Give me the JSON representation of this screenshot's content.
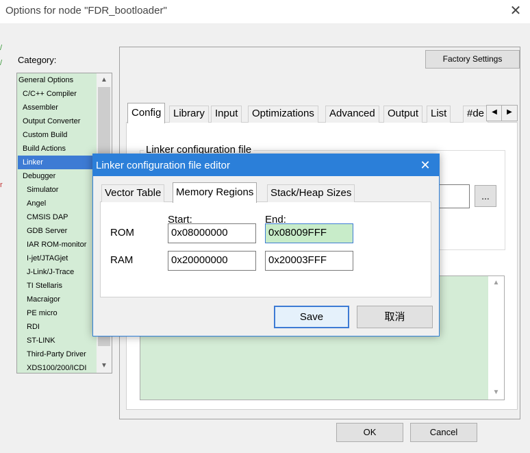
{
  "window": {
    "title": "Options for node \"FDR_bootloader\""
  },
  "category": {
    "label": "Category:",
    "items": [
      {
        "label": "General Options"
      },
      {
        "label": "C/C++ Compiler"
      },
      {
        "label": "Assembler"
      },
      {
        "label": "Output Converter"
      },
      {
        "label": "Custom Build"
      },
      {
        "label": "Build Actions"
      },
      {
        "label": "Linker"
      },
      {
        "label": "Debugger"
      },
      {
        "label": "Simulator"
      },
      {
        "label": "Angel"
      },
      {
        "label": "CMSIS DAP"
      },
      {
        "label": "GDB Server"
      },
      {
        "label": "IAR ROM-monitor"
      },
      {
        "label": "I-jet/JTAGjet"
      },
      {
        "label": "J-Link/J-Trace"
      },
      {
        "label": "TI Stellaris"
      },
      {
        "label": "Macraigor"
      },
      {
        "label": "PE micro"
      },
      {
        "label": "RDI"
      },
      {
        "label": "ST-LINK"
      },
      {
        "label": "Third-Party Driver"
      },
      {
        "label": "XDS100/200/ICDI"
      }
    ],
    "selected": "Linker"
  },
  "right_panel": {
    "factory_settings": "Factory Settings",
    "tabs": [
      "Config",
      "Library",
      "Input",
      "Optimizations",
      "Advanced",
      "Output",
      "List",
      "#de"
    ],
    "active_tab": "Config",
    "linker_config_label": "Linker configuration file",
    "browse_label": "..."
  },
  "footer": {
    "ok": "OK",
    "cancel": "Cancel"
  },
  "editor": {
    "title": "Linker configuration file editor",
    "tabs": [
      "Vector Table",
      "Memory Regions",
      "Stack/Heap Sizes"
    ],
    "active_tab": "Memory Regions",
    "start_label": "Start:",
    "end_label": "End:",
    "rom": {
      "label": "ROM",
      "start": "0x08000000",
      "end": "0x08009FFF"
    },
    "ram": {
      "label": "RAM",
      "start": "0x20000000",
      "end": "0x20003FFF"
    },
    "save": "Save",
    "cancel": "取消"
  },
  "colors": {
    "accent": "#2b7fd9",
    "selection": "#3d7bd4",
    "list_background": "#d4ecd6"
  }
}
